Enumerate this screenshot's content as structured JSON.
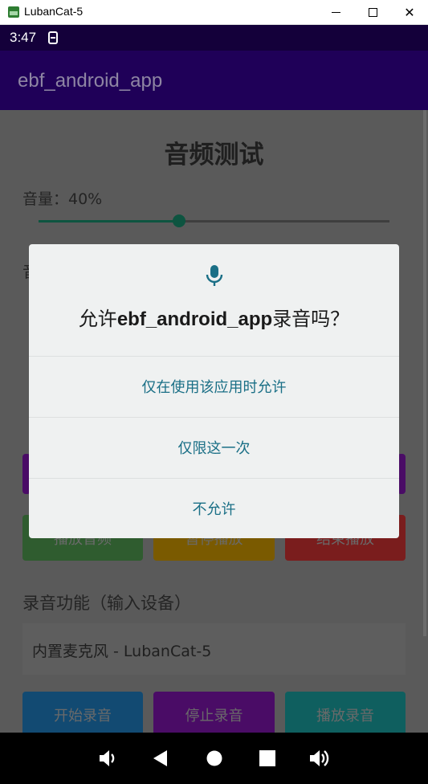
{
  "window": {
    "title": "LubanCat-5",
    "minimize_label": "",
    "maximize_label": "",
    "close_label": "✕"
  },
  "status_bar": {
    "time": "3:47"
  },
  "app_bar": {
    "title": "ebf_android_app"
  },
  "main": {
    "page_title": "音频测试",
    "volume_label": "音量：40%",
    "volume_level": 0.4,
    "partial_label": "音",
    "buttons_row2": [
      {
        "label": "播放音频",
        "color": "#2f5c2f"
      },
      {
        "label": "暂停播放",
        "color": "#7a5a00"
      },
      {
        "label": "结束播放",
        "color": "#7a1d1d"
      }
    ],
    "buttons_row1_colors": [
      "#4a0c66",
      "#4a0c66"
    ],
    "record_section_title": "录音功能（输入设备）",
    "input_device": "内置麦克风 - LubanCat-5",
    "buttons_row3": [
      {
        "label": "开始录音",
        "color": "#124a72"
      },
      {
        "label": "停止录音",
        "color": "#4a0c66"
      },
      {
        "label": "播放录音",
        "color": "#0f5f5f"
      }
    ]
  },
  "dialog": {
    "title_prefix": "允许",
    "title_app": "ebf_android_app",
    "title_suffix": "录音吗？",
    "option_while_using": "仅在使用该应用时允许",
    "option_once": "仅限这一次",
    "option_deny": "不允许",
    "accent_color": "#1a6f86",
    "icon": "microphone-icon"
  },
  "nav_bar": {
    "icons": [
      "volume-down-icon",
      "back-icon",
      "home-icon",
      "recents-icon",
      "volume-up-icon"
    ]
  }
}
